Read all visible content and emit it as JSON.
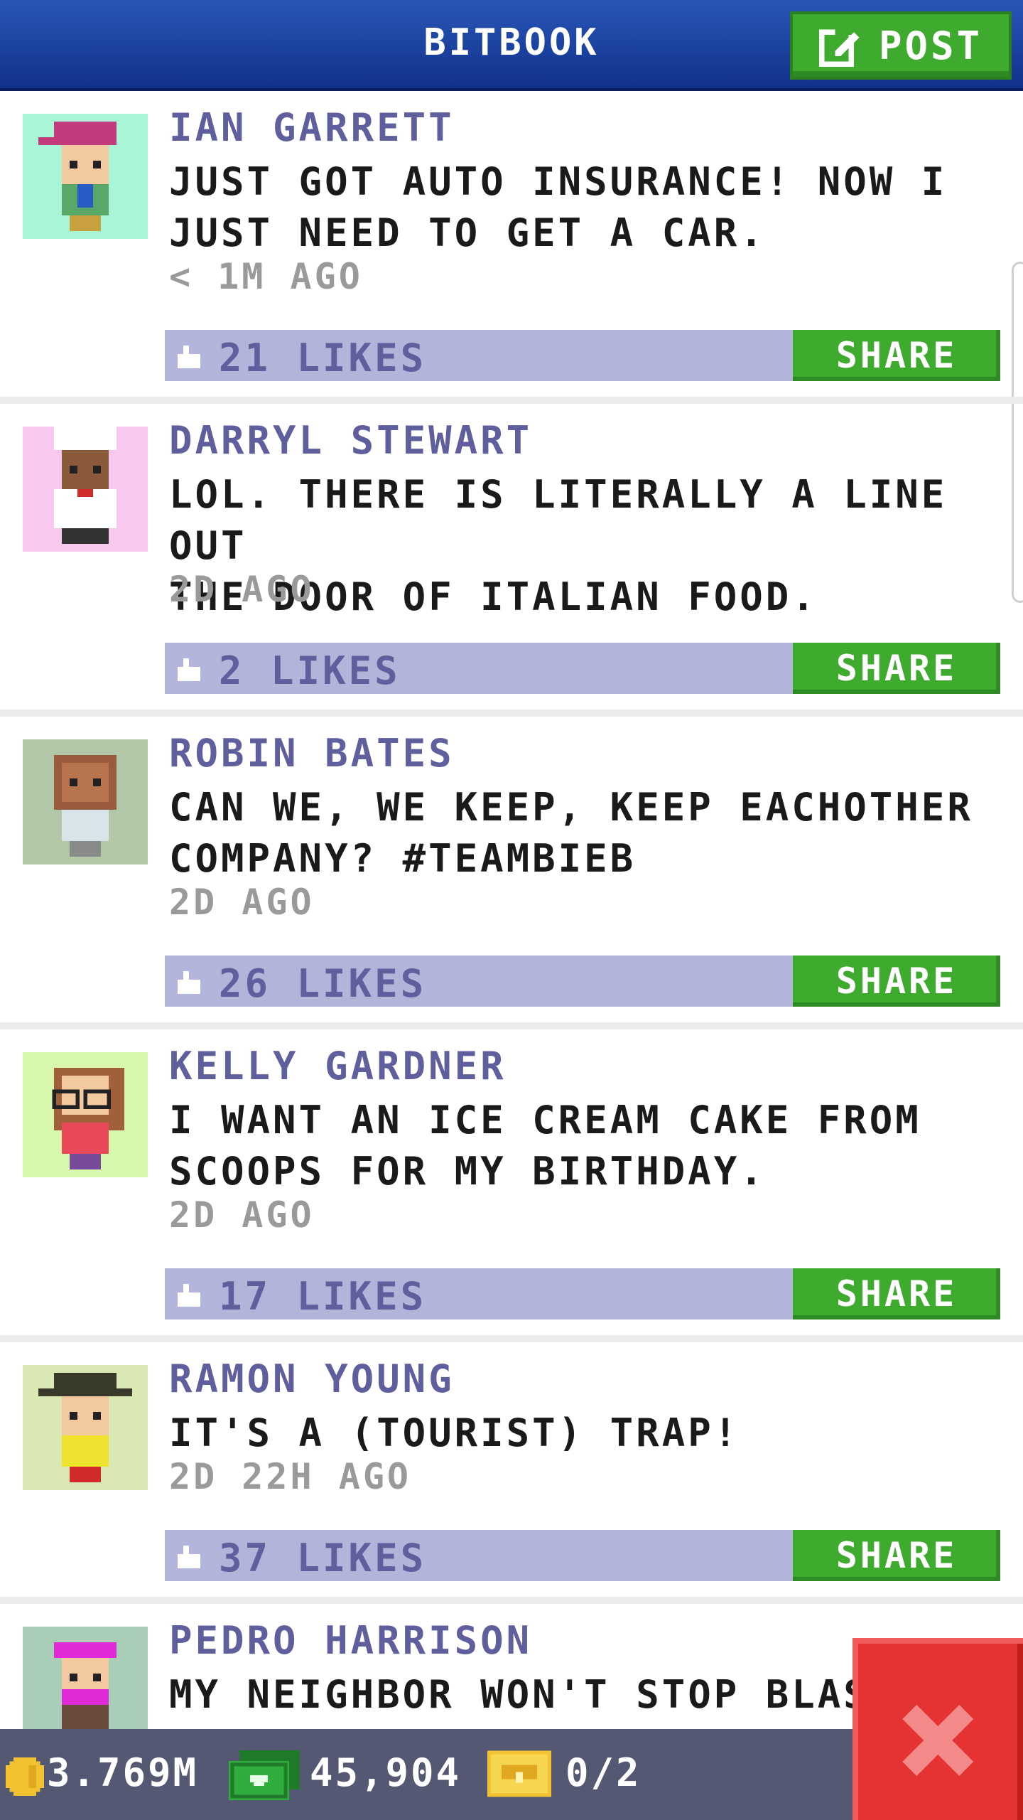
{
  "header": {
    "title": "BITBOOK",
    "post_label": "POST"
  },
  "colors": {
    "header_blue": "#1d43a0",
    "share_green": "#3fab2e",
    "likes_bar": "#b3b4d9",
    "close_red": "#e53232"
  },
  "posts": [
    {
      "author": "IAN GARRETT",
      "message": "JUST GOT AUTO INSURANCE! NOW I\nJUST NEED TO GET A CAR.",
      "time": "< 1M AGO",
      "likes": "21 LIKES",
      "share_label": "SHARE",
      "avatar_bg": "#a8f5d8"
    },
    {
      "author": "DARRYL STEWART",
      "message": "LOL. THERE IS LITERALLY A LINE OUT\nTHE DOOR OF ITALIAN FOOD.",
      "time": "2D AGO",
      "likes": "2 LIKES",
      "share_label": "SHARE",
      "avatar_bg": "#f9c8ee"
    },
    {
      "author": "ROBIN BATES",
      "message": "CAN WE, WE KEEP, KEEP EACHOTHER\nCOMPANY? #TEAMBIEB",
      "time": "2D AGO",
      "likes": "26 LIKES",
      "share_label": "SHARE",
      "avatar_bg": "#b2c6a8"
    },
    {
      "author": "KELLY GARDNER",
      "message": "I WANT AN ICE CREAM CAKE FROM\nSCOOPS FOR MY BIRTHDAY.",
      "time": "2D AGO",
      "likes": "17 LIKES",
      "share_label": "SHARE",
      "avatar_bg": "#d6f7ac"
    },
    {
      "author": "RAMON YOUNG",
      "message": "IT'S A (TOURIST) TRAP!",
      "time": "2D 22H AGO",
      "likes": "37 LIKES",
      "share_label": "SHARE",
      "avatar_bg": "#dae8b4"
    },
    {
      "author": "PEDRO HARRISON",
      "message": "MY NEIGHBOR WON'T STOP BLAS",
      "time": "",
      "likes": "",
      "share_label": "",
      "avatar_bg": "#a9cdb6"
    }
  ],
  "status_bar": {
    "coins": "3.769M",
    "bux": "45,904",
    "tickets": "0/2"
  }
}
